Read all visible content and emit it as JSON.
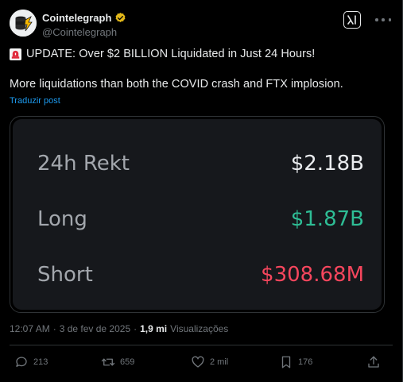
{
  "author": {
    "display_name": "Cointelegraph",
    "handle": "@Cointelegraph",
    "verified": true
  },
  "post": {
    "line1": "UPDATE: Over $2 BILLION Liquidated in Just 24 Hours!",
    "line2": "More liquidations than both the COVID crash and FTX implosion.",
    "translate_label": "Traduzir post"
  },
  "media": {
    "rows": [
      {
        "label": "24h Rekt",
        "value": "$2.18B"
      },
      {
        "label": "Long",
        "value": "$1.87B"
      },
      {
        "label": "Short",
        "value": "$308.68M"
      }
    ]
  },
  "meta": {
    "time": "12:07 AM",
    "date": "3 de fev de 2025",
    "separator": "·",
    "views_count": "1,9 mi",
    "views_label": "Visualizações"
  },
  "actions": {
    "replies": "213",
    "reposts": "659",
    "likes": "2 mil",
    "bookmarks": "176"
  },
  "colors": {
    "accent_link": "#1d9bf0",
    "long_green": "#2ebd95",
    "short_red": "#f6465d",
    "verified_gold": "#e2b719"
  },
  "icons": [
    "cointelegraph-logo-icon",
    "verified-badge-icon",
    "grok-icon",
    "more-icon",
    "siren-icon",
    "reply-icon",
    "repost-icon",
    "like-icon",
    "bookmark-icon",
    "share-icon"
  ]
}
